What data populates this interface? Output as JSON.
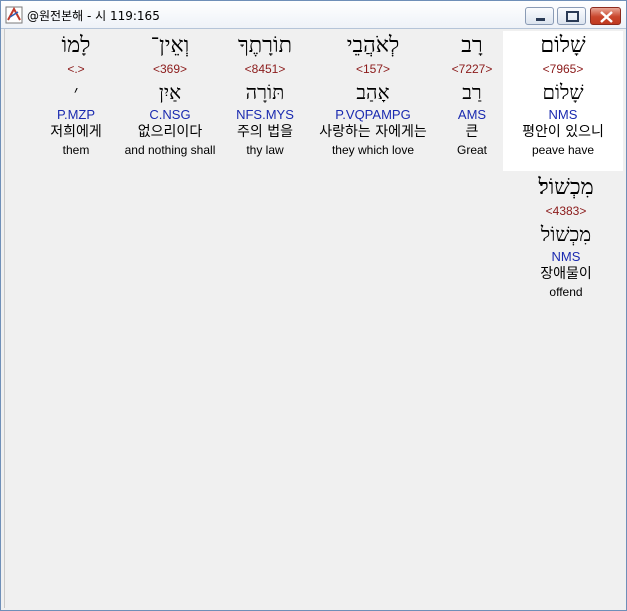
{
  "window": {
    "title": "@원전본해 - 시 119:165"
  },
  "words": [
    {
      "heb": "שָׁלוֹם",
      "strong": "<7965>",
      "lemma": "שָׁלוֹם",
      "morph": "NMS",
      "kor": "평안이 있으니",
      "eng": "peave have"
    },
    {
      "heb": "רָב",
      "strong": "<7227>",
      "lemma": "רַב",
      "morph": "AMS",
      "kor": "큰",
      "eng": "Great"
    },
    {
      "heb": "לְאֹהֲבֵי",
      "strong": "<157>",
      "lemma": "אָהַב",
      "morph": "P.VQPAMPG",
      "kor": "사랑하는 자에게는",
      "eng": "they which love"
    },
    {
      "heb": "תוֹרָתֶךָ",
      "strong": "<8451>",
      "lemma": "תּוֹרָה",
      "morph": "NFS.MYS",
      "kor": "주의 법을",
      "eng": "thy law"
    },
    {
      "heb": "וְאֵין־",
      "strong": "<369>",
      "lemma": "אַיִן",
      "morph": "C.NSG",
      "kor": "없으리이다",
      "eng": "and nothing shall"
    },
    {
      "heb": "לָמוֹ",
      "strong": "<.>",
      "lemma": "׳",
      "morph": "P.MZP",
      "kor": "저희에게",
      "eng": "them"
    },
    {
      "heb": "מִכְשׁוֹל׃",
      "strong": "<4383>",
      "lemma": "מִכְשׁוֹל",
      "morph": "NMS",
      "kor": "장애물이",
      "eng": "offend"
    }
  ]
}
